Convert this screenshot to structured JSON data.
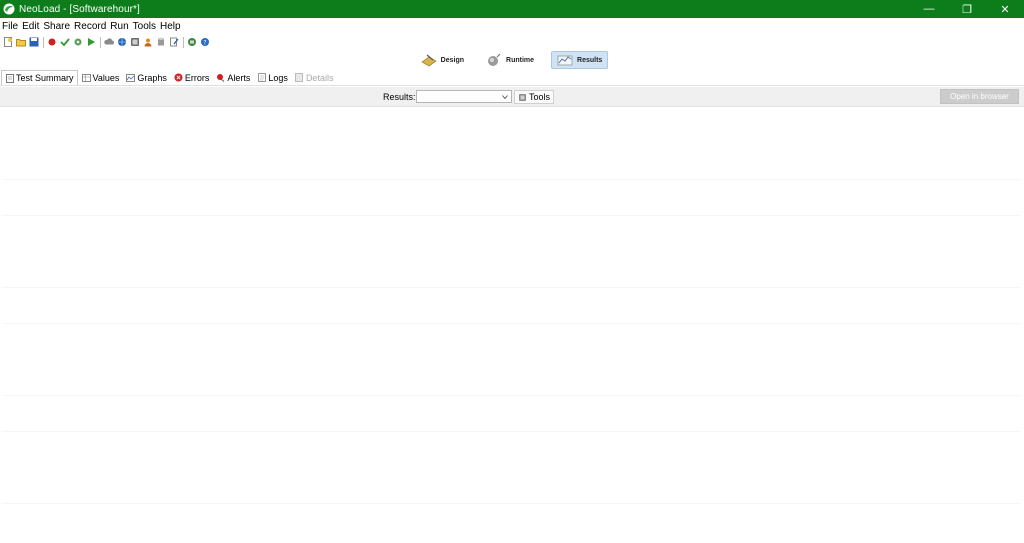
{
  "window": {
    "title": "NeoLoad - [Softwarehour*]",
    "controls": {
      "minimize": "—",
      "restore": "❐",
      "close": "✕"
    }
  },
  "menu": [
    "File",
    "Edit",
    "Share",
    "Record",
    "Run",
    "Tools",
    "Help"
  ],
  "toolbar_icons": [
    "new-project-icon",
    "open-project-icon",
    "save-icon",
    "record-icon",
    "check-icon",
    "settings-icon",
    "run-icon",
    "cloud-icon",
    "globe-icon",
    "monitor-icon",
    "user-icon",
    "cylinder-icon",
    "edit-icon",
    "load-generator-icon",
    "help-icon"
  ],
  "perspectives": [
    {
      "label": "Design",
      "icon": "design-icon",
      "active": false
    },
    {
      "label": "Runtime",
      "icon": "runtime-icon",
      "active": false
    },
    {
      "label": "Results",
      "icon": "results-icon",
      "active": true
    }
  ],
  "tabs": [
    {
      "label": "Test Summary",
      "icon": "document-icon",
      "active": true,
      "disabled": false
    },
    {
      "label": "Values",
      "icon": "table-icon",
      "active": false,
      "disabled": false
    },
    {
      "label": "Graphs",
      "icon": "graph-icon",
      "active": false,
      "disabled": false
    },
    {
      "label": "Errors",
      "icon": "error-icon",
      "active": false,
      "disabled": false
    },
    {
      "label": "Alerts",
      "icon": "alert-icon",
      "active": false,
      "disabled": false
    },
    {
      "label": "Logs",
      "icon": "log-icon",
      "active": false,
      "disabled": false
    },
    {
      "label": "Details",
      "icon": "details-icon",
      "active": false,
      "disabled": true
    }
  ],
  "results_bar": {
    "label": "Results:",
    "select_value": "",
    "tools_label": "Tools",
    "open_browser_label": "Open in browser"
  },
  "colors": {
    "titlebar": "#0d7d1b",
    "active_perspective": "#cfe3f4",
    "disabled_button": "#cccccc"
  }
}
